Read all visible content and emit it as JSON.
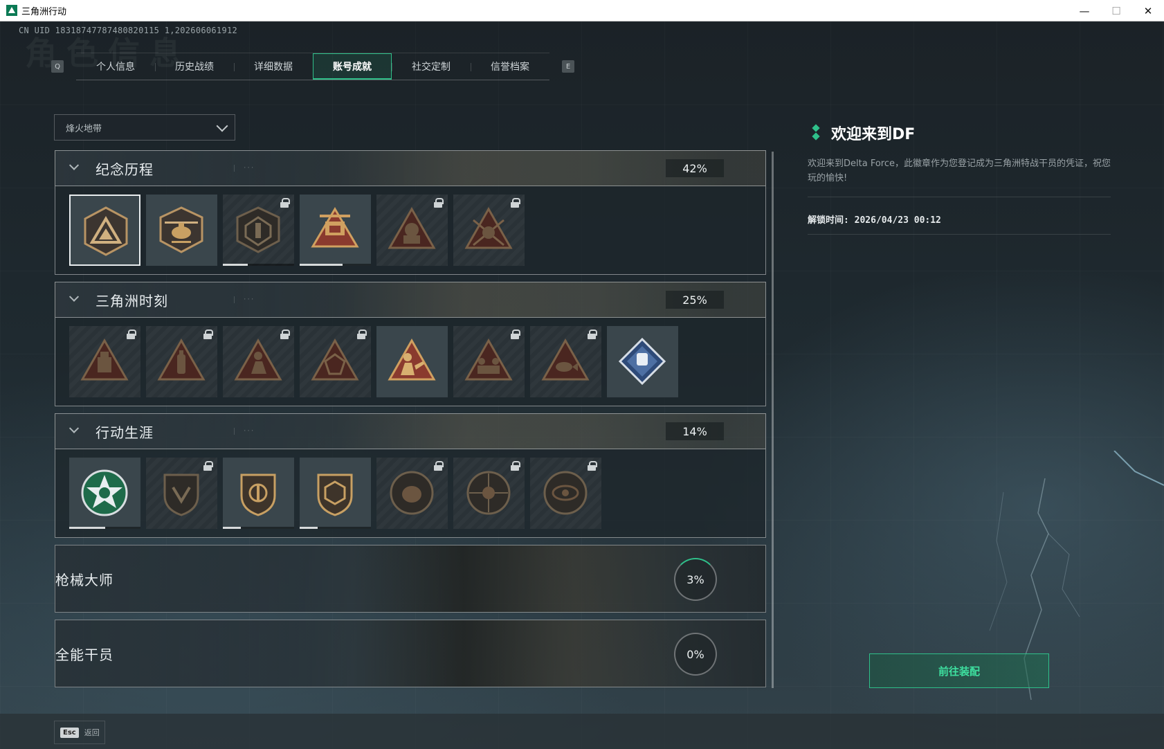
{
  "window": {
    "title": "三角洲行动",
    "min": "—",
    "max": "☐",
    "close": "✕"
  },
  "uid_text": "CN UID 18318747787480820115 1,202606061912",
  "bg_title": "角色信息",
  "tabs": {
    "left_key": "Q",
    "right_key": "E",
    "items": [
      {
        "label": "个人信息"
      },
      {
        "label": "历史战绩"
      },
      {
        "label": "详细数据"
      },
      {
        "label": "账号成就",
        "active": true
      },
      {
        "label": "社交定制"
      },
      {
        "label": "信誉档案"
      }
    ]
  },
  "mode_select": {
    "value": "烽火地带"
  },
  "categories": [
    {
      "name": "纪念历程",
      "progress": "42%",
      "expanded": true,
      "badges": [
        {
          "icon": "delta-triangle-badge",
          "locked": false,
          "selected": true,
          "progress": null
        },
        {
          "icon": "helicopter-badge",
          "locked": false,
          "progress": null
        },
        {
          "icon": "hex-shield-badge",
          "locked": true,
          "progress": 0.35
        },
        {
          "icon": "mech-59-badge",
          "locked": false,
          "progress": 0.6
        },
        {
          "icon": "hooded-operator-badge",
          "locked": true,
          "progress": null
        },
        {
          "icon": "skull-crossed-badge",
          "locked": true,
          "progress": null
        }
      ]
    },
    {
      "name": "三角洲时刻",
      "progress": "25%",
      "expanded": true,
      "badges": [
        {
          "icon": "robot-triangle-badge",
          "locked": true
        },
        {
          "icon": "bottle-triangle-badge",
          "locked": true
        },
        {
          "icon": "kneeling-soldier-badge",
          "locked": true
        },
        {
          "icon": "d20-dice-badge",
          "locked": true
        },
        {
          "icon": "helping-hand-badge",
          "locked": false
        },
        {
          "icon": "squad-triangle-badge",
          "locked": true
        },
        {
          "icon": "fish-triangle-badge",
          "locked": true
        },
        {
          "icon": "fist-diamond-badge",
          "locked": false
        }
      ]
    },
    {
      "name": "行动生涯",
      "progress": "14%",
      "expanded": true,
      "badges": [
        {
          "icon": "green-star-badge",
          "locked": false,
          "progress": 0.5
        },
        {
          "icon": "wing-shield-badge",
          "locked": true,
          "progress": null
        },
        {
          "icon": "rank-shield-badge",
          "locked": false,
          "progress": 0.25
        },
        {
          "icon": "hex-crest-badge",
          "locked": false,
          "progress": 0.25
        },
        {
          "icon": "shell-round-badge",
          "locked": true,
          "progress": null
        },
        {
          "icon": "skull-round-badge",
          "locked": true,
          "progress": null
        },
        {
          "icon": "eye-round-badge",
          "locked": true,
          "progress": null
        }
      ]
    },
    {
      "name": "枪械大师",
      "progress": "3%",
      "expanded": false
    },
    {
      "name": "全能干员",
      "progress": "0%",
      "expanded": false
    }
  ],
  "detail": {
    "title": "欢迎来到DF",
    "description": "欢迎来到Delta Force，此徽章作为您登记成为三角洲特战干员的凭证，祝您玩的愉快!",
    "unlock_time": "解锁时间: 2026/04/23 00:12"
  },
  "equip_button": "前往装配",
  "footer": {
    "esc_key": "Esc",
    "back_label": "返回"
  },
  "colors": {
    "accent": "#2fc08a",
    "badge_gold": "#c8a063",
    "badge_red": "#8a3a2e"
  }
}
